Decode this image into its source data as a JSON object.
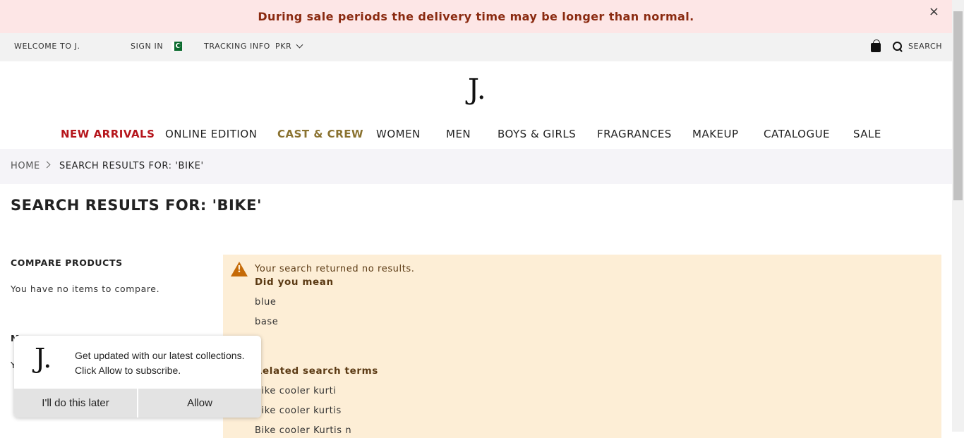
{
  "announcement": {
    "text": "During sale periods the delivery time may be longer than normal.",
    "close": "×"
  },
  "topbar": {
    "welcome": "WELCOME TO J.",
    "sign_in": "SIGN IN",
    "tracking": "TRACKING INFO",
    "currency": "PKR",
    "search": "SEARCH"
  },
  "logo": "J.",
  "nav": [
    {
      "label": "NEW ARRIVALS",
      "color": "#b5151b"
    },
    {
      "label": "ONLINE EDITION",
      "color": "#222222"
    },
    {
      "label": "CAST & CREW",
      "color": "#8a7230"
    },
    {
      "label": "WOMEN",
      "color": "#222222"
    },
    {
      "label": "MEN",
      "color": "#222222"
    },
    {
      "label": "BOYS & GIRLS",
      "color": "#222222"
    },
    {
      "label": "FRAGRANCES",
      "color": "#222222"
    },
    {
      "label": "MAKEUP",
      "color": "#222222"
    },
    {
      "label": "CATALOGUE",
      "color": "#222222"
    },
    {
      "label": "SALE",
      "color": "#222222"
    }
  ],
  "breadcrumb": {
    "home": "HOME",
    "current": "SEARCH RESULTS FOR: 'BIKE'"
  },
  "page_title": "SEARCH RESULTS FOR: 'BIKE'",
  "compare": {
    "title": "COMPARE PRODUCTS",
    "text": "You have no items to compare."
  },
  "sidebar_hidden": {
    "a": "M",
    "b": "Y"
  },
  "notice": {
    "message": "Your search returned no results.",
    "did_you_mean": "Did you mean",
    "suggestions": [
      "blue",
      "base"
    ],
    "related_title": "Related search terms",
    "related": [
      "Bike cooler kurti",
      "Bike cooler kurtis",
      "Bike cooler Kurtis n"
    ]
  },
  "popup": {
    "logo": "J.",
    "line1": "Get updated with our latest collections.",
    "line2": "Click Allow to subscribe.",
    "later": "I'll do this later",
    "allow": "Allow"
  }
}
